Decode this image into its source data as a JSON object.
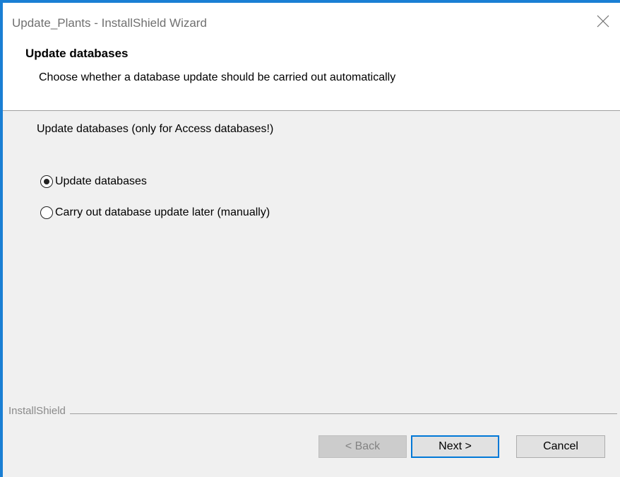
{
  "window": {
    "title": "Update_Plants - InstallShield Wizard",
    "accent_color": "#1a7fd4"
  },
  "header": {
    "title": "Update databases",
    "description": "Choose whether a database update should be carried out automatically"
  },
  "body": {
    "section_label": "Update databases (only for Access databases!)",
    "options": [
      {
        "label": "Update databases",
        "selected": true
      },
      {
        "label": "Carry out database update later (manually)",
        "selected": false
      }
    ]
  },
  "footer": {
    "brand": "InstallShield",
    "back_label": "< Back",
    "next_label": "Next >",
    "cancel_label": "Cancel",
    "back_enabled": false
  },
  "icons": {
    "close": "close-icon"
  }
}
